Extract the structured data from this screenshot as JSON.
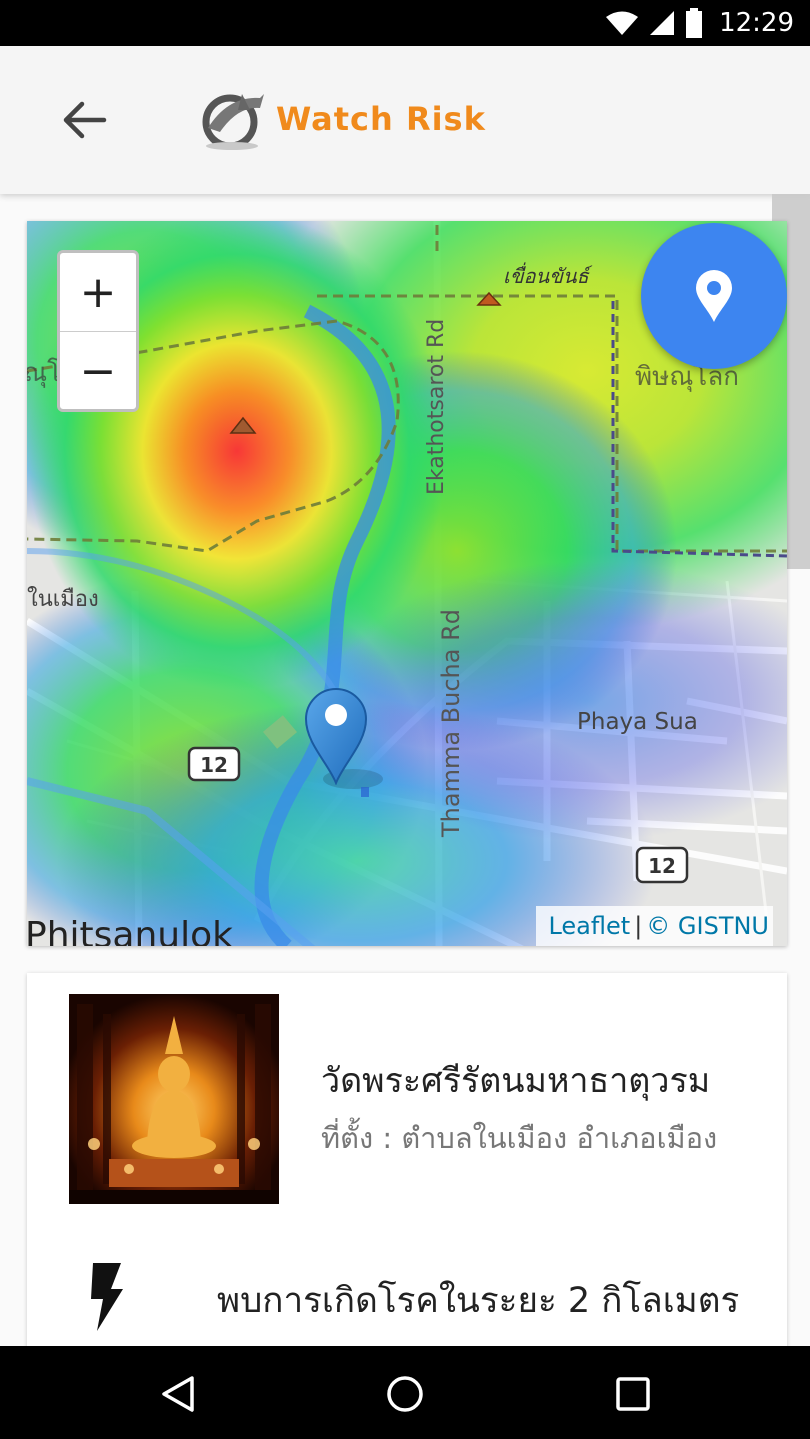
{
  "status_bar": {
    "time": "12:29"
  },
  "app_bar": {
    "title": "Watch Risk"
  },
  "map": {
    "labels": {
      "dam": "เขื่อนขันธ์",
      "ekathotsarot": "Ekathotsarot Rd",
      "thamma_bucha": "Thamma Bucha Rd",
      "phaya_sua": "Phaya Sua",
      "nai_mueang": "ในเมือง",
      "phitsanulok_thai": "พิษณุโลก",
      "phitsanulok_left": "ณุโล",
      "phitsanulok_en": "Phitsanulok",
      "route_12_a": "12",
      "route_12_b": "12"
    },
    "zoom_in_label": "+",
    "zoom_out_label": "−",
    "attribution": {
      "leaflet": "Leaflet",
      "separator": "|",
      "copyright": "© GISTNU"
    }
  },
  "place": {
    "name": "วัดพระศรีรัตนมหาธาตุวรม",
    "location": "ที่ตั้ง : ตำบลในเมือง อำเภอเมือง",
    "alert_text": "พบการเกิดโรคในระยะ 2 กิโลเมตร"
  },
  "colors": {
    "accent": "#f08a1c",
    "fab": "#3d85f0",
    "link": "#0078a8",
    "marker": "#2d83d0"
  }
}
